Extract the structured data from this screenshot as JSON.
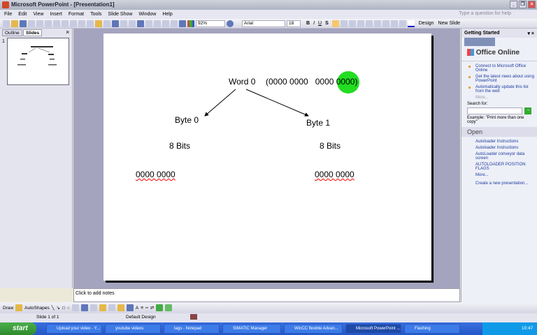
{
  "window": {
    "title": "Microsoft PowerPoint - [Presentation1]"
  },
  "menu": [
    "File",
    "Edit",
    "View",
    "Insert",
    "Format",
    "Tools",
    "Slide Show",
    "Window",
    "Help"
  ],
  "help_placeholder": "Type a question for help",
  "toolbar": {
    "zoom": "92%",
    "font": "Arial",
    "size": "18",
    "bold": "B",
    "italic": "I",
    "underline": "U",
    "shadow": "S",
    "design": "Design",
    "new_slide": "New Slide"
  },
  "left_pane": {
    "tabs": [
      "Outline",
      "Slides"
    ],
    "slide_number": "1"
  },
  "slide": {
    "word": "Word 0",
    "word_bits": "(0000 0000   0000 0000)",
    "byte0": "Byte 0",
    "byte1": "Byte 1",
    "bits0": "8 Bits",
    "bits1": "8 Bits",
    "val0": "0000 0000",
    "val1": "0000 0000",
    "highlight_color": "#22dd22"
  },
  "notes_placeholder": "Click to add notes",
  "task_pane": {
    "title": "Getting Started",
    "brand": "Office Online",
    "links": [
      "Connect to Microsoft Office Online",
      "Get the latest news about using PowerPoint",
      "Automatically update this list from the web"
    ],
    "more": "More...",
    "search_label": "Search for:",
    "example": "Example:  \"Print more than one copy\"",
    "open_title": "Open",
    "files": [
      "Autoloader Instructions",
      "Autoloader Instructions",
      "AutoLoader conveyor data screen",
      "AUTOLOADER POSITION FLAGS"
    ],
    "open_more": "More...",
    "create": "Create a new presentation..."
  },
  "draw": {
    "draw": "Draw",
    "autoshapes": "AutoShapes"
  },
  "status": {
    "slide": "Slide 1 of 1",
    "design": "Default Design"
  },
  "taskbar": {
    "start": "start",
    "items": [
      "Upload your video - Y...",
      "youtube videos",
      "tags - Notepad",
      "SIMATIC Manager",
      "WinCC flexible Advan...",
      "Microsoft PowerPoint ...",
      "Flashing"
    ],
    "clock": "10:47"
  }
}
